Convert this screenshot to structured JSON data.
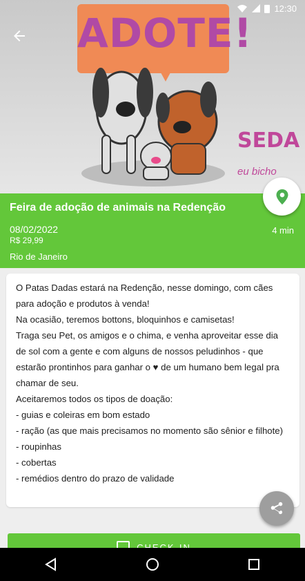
{
  "status_bar": {
    "time": "12:30"
  },
  "hero": {
    "sign_text": "ADOTE!",
    "seda_logo": "SEDA",
    "partner_logo": "eu bicho"
  },
  "event": {
    "title": "Feira de adoção de animais na Redenção",
    "date": "08/02/2022",
    "price": "R$ 29,99",
    "duration": "4 min",
    "location": "Rio de Janeiro"
  },
  "description": {
    "lines": [
      "O Patas Dadas estará na Redenção, nesse domingo, com cães para adoção e produtos à venda!",
      "Na ocasião, teremos bottons, bloquinhos e camisetas!",
      "Traga seu Pet, os amigos e o chima, e venha aproveitar esse dia de sol com a gente e com alguns de nossos peludinhos - que estarão prontinhos para ganhar o ♥ de um humano bem legal pra chamar de seu.",
      "Aceitaremos todos os tipos de doação:",
      "- guias e coleiras em bom estado",
      "- ração (as que mais precisamos no momento são sênior e filhote)",
      "- roupinhas",
      "- cobertas",
      "- remédios dentro do prazo de validade"
    ]
  },
  "actions": {
    "checkin_label": "CHECK-IN"
  },
  "colors": {
    "accent": "#63c73a",
    "sign": "#f08a55",
    "logo": "#c0489a"
  },
  "icons": {
    "back": "arrow-left-icon",
    "map": "map-pin-icon",
    "share": "share-icon",
    "nav_back": "triangle-back-icon",
    "nav_home": "circle-home-icon",
    "nav_recents": "square-recents-icon"
  }
}
